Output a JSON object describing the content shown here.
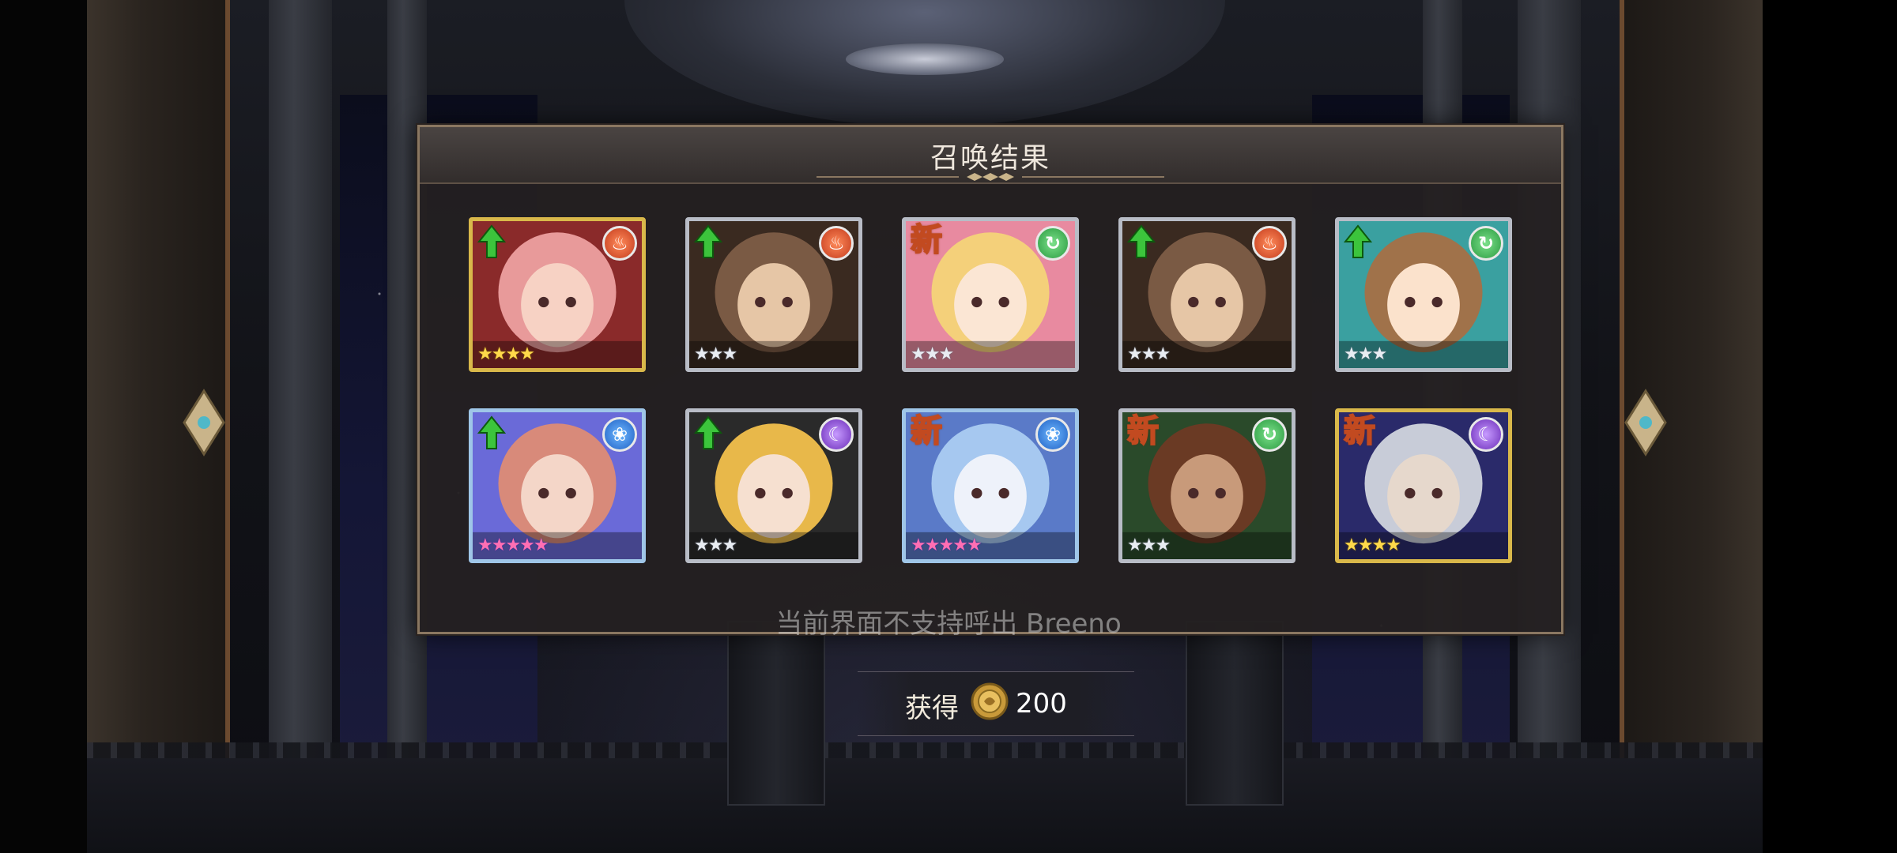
{
  "dialog": {
    "title": "召唤结果"
  },
  "summon_results": [
    {
      "name": "pink-hair-girl",
      "badge": "up",
      "element": "fire",
      "frame": "gold",
      "rarity": 4,
      "stars_text": "★★★★"
    },
    {
      "name": "brown-hair-boy",
      "badge": "up",
      "element": "fire",
      "frame": "silver",
      "rarity": 3,
      "stars_text": "★★★"
    },
    {
      "name": "blonde-flower-girl",
      "badge": "new",
      "badge_text": "新",
      "element": "wind",
      "frame": "silver",
      "rarity": 3,
      "stars_text": "★★★"
    },
    {
      "name": "brown-hair-boy",
      "badge": "up",
      "element": "fire",
      "frame": "silver",
      "rarity": 3,
      "stars_text": "★★★"
    },
    {
      "name": "brown-hair-girl",
      "badge": "up",
      "element": "wind",
      "frame": "silver",
      "rarity": 3,
      "stars_text": "★★★"
    },
    {
      "name": "sleepy-redhead",
      "badge": "up",
      "element": "water",
      "frame": "rainbow",
      "rarity": 5,
      "stars_text": "★★★★★"
    },
    {
      "name": "masked-blonde",
      "badge": "up",
      "element": "dark",
      "frame": "silver",
      "rarity": 3,
      "stars_text": "★★★"
    },
    {
      "name": "blue-hair-woman",
      "badge": "new",
      "badge_text": "新",
      "element": "water",
      "frame": "rainbow",
      "rarity": 5,
      "stars_text": "★★★★★"
    },
    {
      "name": "bearded-man",
      "badge": "new",
      "badge_text": "新",
      "element": "wind",
      "frame": "silver",
      "rarity": 3,
      "stars_text": "★★★"
    },
    {
      "name": "silver-hair-man",
      "badge": "new",
      "badge_text": "新",
      "element": "dark",
      "frame": "gold",
      "rarity": 4,
      "stars_text": "★★★★"
    }
  ],
  "element_glyphs": {
    "fire": "🔥",
    "wind": "@",
    "water": "💧",
    "dark": "☾"
  },
  "toast": "当前界面不支持呼出 Breeno",
  "reward": {
    "label": "获得",
    "value": "200",
    "icon": "gold-coin-icon"
  },
  "colors": {
    "dialog_border": "#8a7761",
    "gold_frame": "#d9b84a",
    "silver_frame": "#b8bcc6",
    "new_badge": "#c24a20",
    "up_arrow": "#3cc43c"
  }
}
